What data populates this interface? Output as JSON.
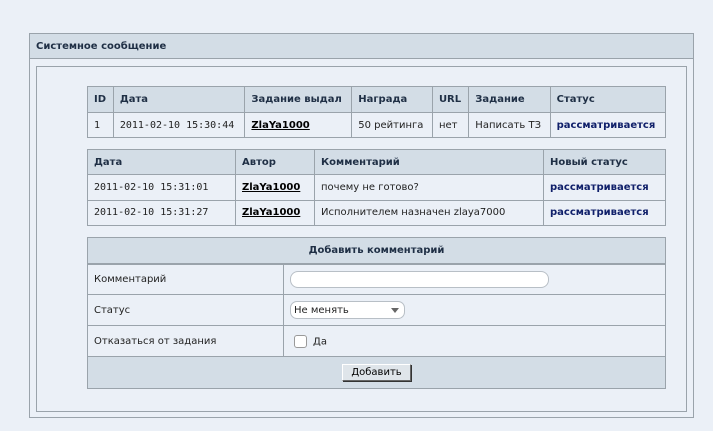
{
  "panel": {
    "title": "Системное сообщение"
  },
  "task_table": {
    "headers": [
      "ID",
      "Дата",
      "Задание выдал",
      "Награда",
      "URL",
      "Задание",
      "Статус"
    ],
    "row": {
      "id": "1",
      "date": "2011-02-10 15:30:44",
      "issuer": "ZlaYa1000",
      "reward": "50 рейтинга",
      "url": "нет",
      "task": "Написать ТЗ",
      "status": "рассматривается"
    }
  },
  "comments_table": {
    "headers": [
      "Дата",
      "Автор",
      "Комментарий",
      "Новый статус"
    ],
    "rows": [
      {
        "date": "2011-02-10 15:31:01",
        "author": "ZlaYa1000",
        "comment": "почему не готово?",
        "status": "рассматривается"
      },
      {
        "date": "2011-02-10 15:31:27",
        "author": "ZlaYa1000",
        "comment": "Исполнителем назначен zlaya7000",
        "status": "рассматривается"
      }
    ]
  },
  "form": {
    "title": "Добавить комментарий",
    "comment_label": "Комментарий",
    "comment_value": "",
    "status_label": "Статус",
    "status_value": "Не менять",
    "refuse_label": "Отказаться от задания",
    "refuse_option": "Да",
    "submit": "Добавить"
  }
}
